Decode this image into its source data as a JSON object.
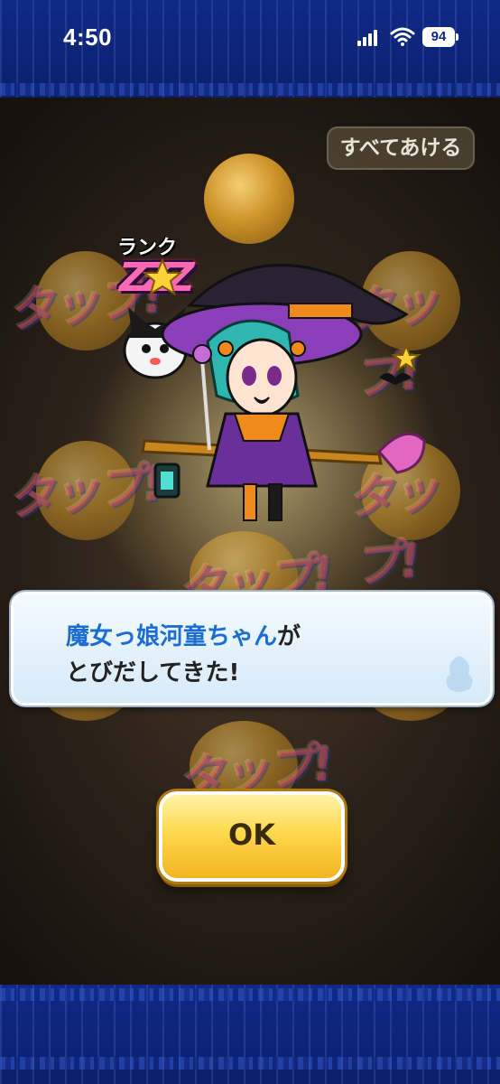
{
  "status_bar": {
    "time": "4:50",
    "battery": "94"
  },
  "game": {
    "open_all_button": "すべてあける",
    "tap_prompt": "タップ!",
    "rank_label": "ランク",
    "rank_value": "ZZZ"
  },
  "dialog": {
    "character_name": "魔女っ娘河童ちゃん",
    "line1_suffix": "が",
    "line2": "とびだしてきた!"
  },
  "ok_button": {
    "label": "OK"
  },
  "colors": {
    "frame_blue": "#0f2a86",
    "name_blue": "#1b6dd1",
    "ok_yellow": "#ffd84d"
  }
}
